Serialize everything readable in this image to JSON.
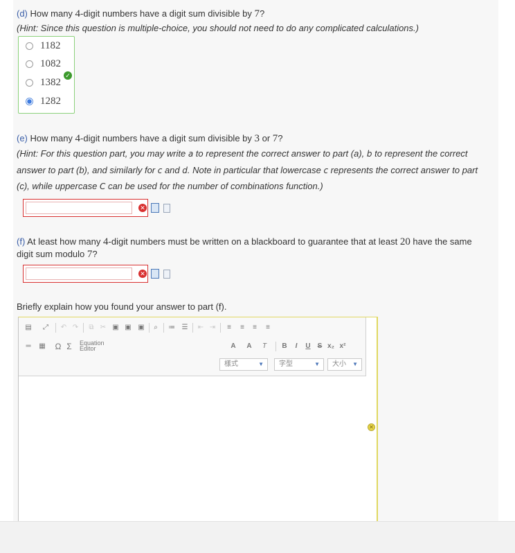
{
  "part_d": {
    "label": "(d)",
    "q_a": "How many ",
    "q_4": "4",
    "q_b": "-digit numbers have a digit sum divisible by ",
    "q_7": "7",
    "q_c": "?",
    "hint": "(Hint: Since this question is multiple-choice, you should not need to do any complicated calculations.)",
    "choices": [
      "1182",
      "1082",
      "1382",
      "1282"
    ],
    "selected_index": 3,
    "correct_index": 2
  },
  "part_e": {
    "label": "(e)",
    "q_a": "How many ",
    "q_4": "4",
    "q_b": "-digit numbers have a digit sum divisible by ",
    "q_3": "3",
    "q_or": " or ",
    "q_7": "7",
    "q_c": "?",
    "hint1_a": "(Hint: For this question part, you may write ",
    "a": "a",
    "hint1_b": " to represent the correct answer to part (a), ",
    "b": "b",
    "hint1_c": " to represent the correct",
    "hint2_a": "answer to part (b), and similarly for ",
    "c": "c",
    "hint2_and": " and ",
    "d": "d",
    "hint2_b": ". Note in particular that lowercase ",
    "c2": "c",
    "hint2_c": " represents the correct answer to part",
    "hint3_a": "(c), while uppercase ",
    "C": "C",
    "hint3_b": " can be used for the number of combinations function.)",
    "answer_value": ""
  },
  "part_f": {
    "label": "(f)",
    "q_a": " At least how many ",
    "q_4": "4",
    "q_b": "-digit numbers must be written on a blackboard to guarantee that at least ",
    "q_20": "20",
    "q_c": " have the same",
    "q_line2a": "digit sum modulo ",
    "q_7": "7",
    "q_line2b": "?",
    "answer_value": ""
  },
  "explain": {
    "prompt": "Briefly explain how you found your answer to part (f).",
    "equation_line1": "Equation",
    "equation_line2": "Editor",
    "styles_label": "樣式",
    "format_label": "字型",
    "size_label": "大小"
  },
  "colors": {
    "accent": "#3a5ea8",
    "error": "#d83030",
    "correct": "#3c9a2c",
    "selected": "#3d7be0"
  },
  "icons": {
    "correct": "check-circle-icon",
    "error": "x-circle-icon",
    "warning": "x-circle-yellow-icon"
  }
}
